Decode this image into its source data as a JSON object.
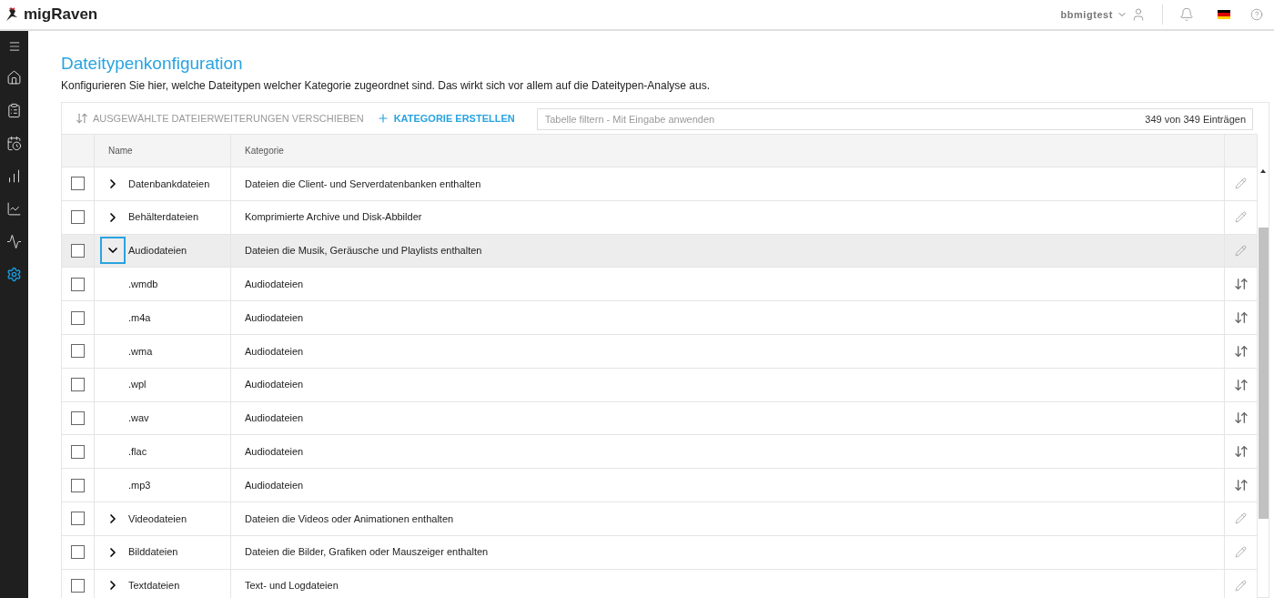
{
  "header": {
    "logo": "migRaven",
    "user": "bbmigtest"
  },
  "sidebar": {
    "items": [
      {
        "selected": false
      },
      {
        "selected": false
      },
      {
        "selected": false
      },
      {
        "selected": false
      },
      {
        "selected": false
      },
      {
        "selected": false
      },
      {
        "selected": true
      }
    ]
  },
  "page": {
    "title": "Dateitypenkonfiguration",
    "description": "Konfigurieren Sie hier, welche Dateitypen welcher Kategorie zugeordnet sind. Das wirkt sich vor allem auf die Dateitypen-Analyse aus."
  },
  "toolbar": {
    "move_button": {
      "label": "AUSGEWÄHLTE DATEIERWEITERUNGEN VERSCHIEBEN",
      "disabled": true
    },
    "create_button": "KATEGORIE ERSTELLEN",
    "filter": {
      "placeholder": "Tabelle filtern - Mit Eingabe anwenden"
    },
    "count": "349 von 349 Einträgen"
  },
  "table": {
    "columns": [
      "Name",
      "Kategorie"
    ],
    "rows": [
      {
        "kind": "group",
        "name": "Datenbankdateien",
        "category": "Dateien die Client- und Serverdatenbanken enthalten",
        "expanded": false,
        "checked": false,
        "hovered": false
      },
      {
        "kind": "group",
        "name": "Behälterdateien",
        "category": "Komprimierte Archive und Disk-Abbilder",
        "expanded": false,
        "checked": false,
        "hovered": false
      },
      {
        "kind": "group",
        "name": "Audiodateien",
        "category": "Dateien die Musik, Geräusche und Playlists enthalten",
        "expanded": true,
        "checked": false,
        "hovered": true
      },
      {
        "kind": "extension",
        "name": ".wmdb",
        "category": "Audiodateien",
        "checked": false,
        "hovered": false
      },
      {
        "kind": "extension",
        "name": ".m4a",
        "category": "Audiodateien",
        "checked": false,
        "hovered": false
      },
      {
        "kind": "extension",
        "name": ".wma",
        "category": "Audiodateien",
        "checked": false,
        "hovered": false
      },
      {
        "kind": "extension",
        "name": ".wpl",
        "category": "Audiodateien",
        "checked": false,
        "hovered": false
      },
      {
        "kind": "extension",
        "name": ".wav",
        "category": "Audiodateien",
        "checked": false,
        "hovered": false
      },
      {
        "kind": "extension",
        "name": ".flac",
        "category": "Audiodateien",
        "checked": false,
        "hovered": false
      },
      {
        "kind": "extension",
        "name": ".mp3",
        "category": "Audiodateien",
        "checked": false,
        "hovered": false
      },
      {
        "kind": "group",
        "name": "Videodateien",
        "category": "Dateien die Videos oder Animationen enthalten",
        "expanded": false,
        "checked": false,
        "hovered": false
      },
      {
        "kind": "group",
        "name": "Bilddateien",
        "category": "Dateien die Bilder, Grafiken oder Mauszeiger enthalten",
        "expanded": false,
        "checked": false,
        "hovered": false
      },
      {
        "kind": "group",
        "name": "Textdateien",
        "category": "Text- und Logdateien",
        "expanded": false,
        "checked": false,
        "hovered": false
      }
    ]
  }
}
